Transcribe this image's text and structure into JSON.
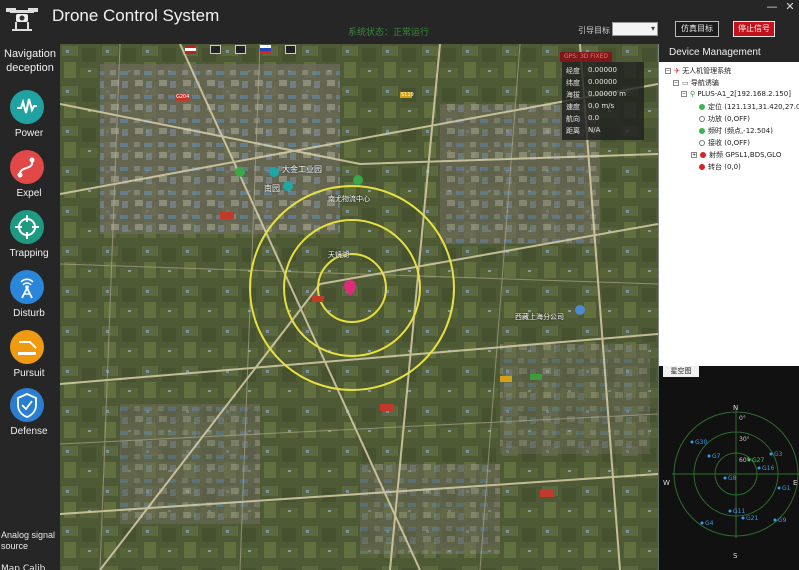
{
  "app": {
    "title": "Drone Control System",
    "minimize_glyph": "—",
    "close_glyph": "✕",
    "center_status": "系统状态：正常运行",
    "target_label": "引导目标",
    "target_value": "",
    "sim_target_button": "仿真目标",
    "stop_button": "停止信号"
  },
  "sidebar": {
    "title": "Navigation deception",
    "items": [
      {
        "label": "Power",
        "icon": "waveform-icon",
        "color": "#20a3a0"
      },
      {
        "label": "Expel",
        "icon": "route-icon",
        "color": "#e34848"
      },
      {
        "label": "Trapping",
        "icon": "crosshair-icon",
        "color": "#1e9a82"
      },
      {
        "label": "Disturb",
        "icon": "antenna-icon",
        "color": "#2a86d8"
      },
      {
        "label": "Pursuit",
        "icon": "pursuit-icon",
        "color": "#f09a12"
      },
      {
        "label": "Defense",
        "icon": "shield-icon",
        "color": "#2a7ed0"
      }
    ],
    "analog_source": "Analog signal source",
    "bottom_cut": "Map Calib"
  },
  "map": {
    "banner": "GPS: 3D FIXED",
    "info": [
      {
        "k": "经度",
        "v": "0.00000"
      },
      {
        "k": "纬度",
        "v": "0.00000"
      },
      {
        "k": "海拔",
        "v": "0.00000 m"
      },
      {
        "k": "速度",
        "v": "0.0 m/s"
      },
      {
        "k": "航向",
        "v": "0.0"
      },
      {
        "k": "距离",
        "v": "N/A"
      }
    ],
    "labels": [
      {
        "t": "大金工业园",
        "cls": "white"
      },
      {
        "t": "南园",
        "cls": "white"
      },
      {
        "t": "南尤物流中心",
        "cls": "white"
      },
      {
        "t": "西藏上海分公司",
        "cls": "white"
      },
      {
        "t": "天镜湖",
        "cls": "white"
      },
      {
        "t": "G204",
        "cls": "road"
      },
      {
        "t": "S119",
        "cls": "road"
      }
    ],
    "accent": "#e8e040"
  },
  "device": {
    "header": "Device Management",
    "tree": [
      {
        "text": "无人机管理系统",
        "level": 0,
        "kind": "root"
      },
      {
        "text": "导航诱骗",
        "level": 1,
        "kind": "folder"
      },
      {
        "text": "PLUS-A1_2[192.168.2.150]",
        "level": 2,
        "kind": "device"
      },
      {
        "text": "定位 (121.131,31.420,27.0)",
        "level": 3,
        "kind": "green"
      },
      {
        "text": "功放 (0,OFF)",
        "level": 3,
        "kind": "white"
      },
      {
        "text": "频时 (频点,-12.504)",
        "level": 3,
        "kind": "green"
      },
      {
        "text": "接收 (0,OFF)",
        "level": 3,
        "kind": "white"
      },
      {
        "text": "射频 GPSL1,BDS,GLO",
        "level": 3,
        "kind": "red"
      },
      {
        "text": "转台 (0,0)",
        "level": 3,
        "kind": "red"
      }
    ]
  },
  "sky": {
    "tab": "星空图",
    "n": "N",
    "s": "S",
    "w": "W",
    "e": "E",
    "deg0": "0°",
    "deg30": "30°",
    "deg60": "60°",
    "sats": [
      {
        "id": "G30"
      },
      {
        "id": "G7"
      },
      {
        "id": "G27"
      },
      {
        "id": "G16"
      },
      {
        "id": "G8"
      },
      {
        "id": "G11"
      },
      {
        "id": "G4"
      },
      {
        "id": "G21"
      },
      {
        "id": "G1"
      },
      {
        "id": "G3"
      },
      {
        "id": "G9"
      }
    ]
  }
}
